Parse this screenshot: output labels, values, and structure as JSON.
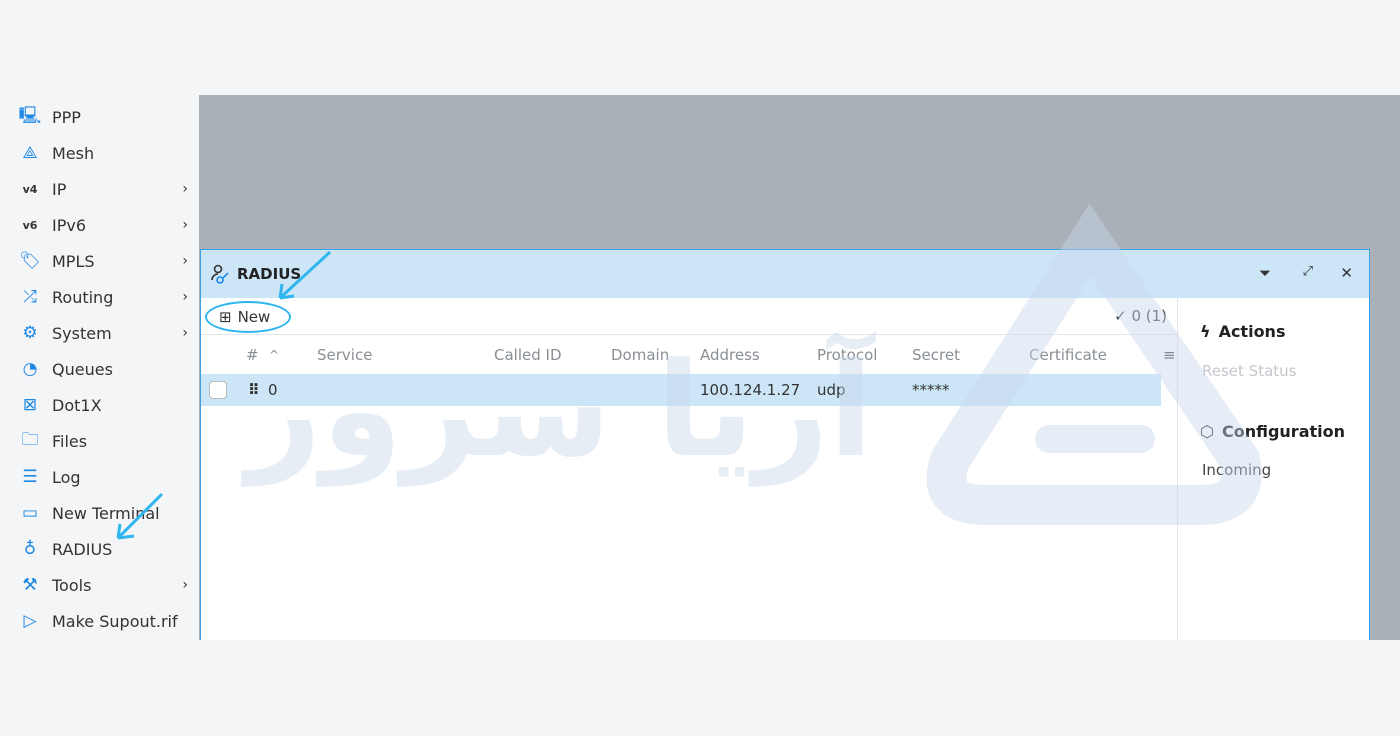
{
  "sidebar": {
    "items": [
      {
        "label": "PPP",
        "icon": "ppp-icon",
        "submenu": false
      },
      {
        "label": "Mesh",
        "icon": "mesh-icon",
        "submenu": false
      },
      {
        "label": "IP",
        "icon": "ipv4-icon",
        "submenu": true
      },
      {
        "label": "IPv6",
        "icon": "ipv6-icon",
        "submenu": true
      },
      {
        "label": "MPLS",
        "icon": "mpls-tag-icon",
        "submenu": true
      },
      {
        "label": "Routing",
        "icon": "routing-shuffle-icon",
        "submenu": true
      },
      {
        "label": "System",
        "icon": "gear-icon",
        "submenu": true
      },
      {
        "label": "Queues",
        "icon": "gauge-icon",
        "submenu": false
      },
      {
        "label": "Dot1X",
        "icon": "dot1x-icon",
        "submenu": false
      },
      {
        "label": "Files",
        "icon": "folder-icon",
        "submenu": false
      },
      {
        "label": "Log",
        "icon": "log-icon",
        "submenu": false
      },
      {
        "label": "New Terminal",
        "icon": "terminal-icon",
        "submenu": false
      },
      {
        "label": "RADIUS",
        "icon": "radius-icon",
        "submenu": false
      },
      {
        "label": "Tools",
        "icon": "tools-icon",
        "submenu": true
      },
      {
        "label": "Make Supout.rif",
        "icon": "file-play-icon",
        "submenu": false
      }
    ]
  },
  "window": {
    "title": "RADIUS",
    "new_label": "New",
    "count": "0 (1)",
    "columns": [
      "#",
      "Service",
      "Called ID",
      "Domain",
      "Address",
      "Protocol",
      "Secret",
      "Certificate"
    ],
    "rows": [
      {
        "num": "0",
        "service": "",
        "called_id": "",
        "domain": "",
        "address": "100.124.1.27",
        "protocol": "udp",
        "secret": "*****",
        "certificate": ""
      }
    ],
    "actions_title": "Actions",
    "reset_status": "Reset Status",
    "configuration_title": "Configuration",
    "incoming": "Incoming"
  },
  "watermark": "آریا سرور",
  "colors": {
    "accent": "#3aa0e8",
    "selected_row": "#cce6f8",
    "annotation": "#2fb6ee"
  }
}
